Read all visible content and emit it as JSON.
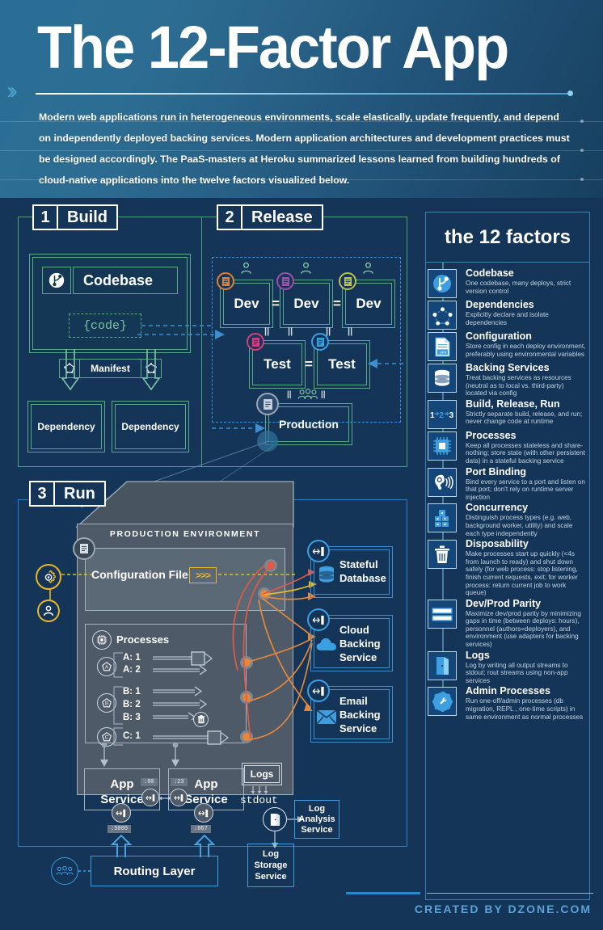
{
  "header": {
    "title": "The 12-Factor App",
    "subtitle": "Modern web applications run in heterogeneous environments, scale elastically, update frequently, and depend on independently deployed backing services. Modern application architectures and development practices must be designed accordingly. The PaaS-masters at Heroku summarized lessons learned from building hundreds of cloud-native applications into the twelve factors visualized below.",
    "chevron_icon": "double-chevron-right-icon"
  },
  "stages": [
    {
      "number": "1",
      "label": "Build"
    },
    {
      "number": "2",
      "label": "Release"
    },
    {
      "number": "3",
      "label": "Run"
    }
  ],
  "build": {
    "codebase_label": "Codebase",
    "codebase_icon": "git-branch-icon",
    "code_label": "{code}",
    "manifest_label": "Manifest",
    "manifest_icon_left": "pentagon-node-icon",
    "manifest_icon_right": "pentagon-node-icon",
    "dependencies": [
      "Dependency",
      "Dependency"
    ]
  },
  "release": {
    "dev_boxes": [
      "Dev",
      "Dev",
      "Dev"
    ],
    "test_boxes": [
      "Test",
      "Test"
    ],
    "production_label": "Production",
    "equals_label": "=",
    "parallel_label": "||",
    "user_icon": "person-icon",
    "group_icon": "people-group-icon",
    "doc_icon": "document-icon"
  },
  "run": {
    "prod_env_title": "PRODUCTION ENVIRONMENT",
    "config_file_label": "Configuration File",
    "config_arrows_label": ">>>",
    "gear_icon": "gear-config-icon",
    "person_icon": "person-circle-icon",
    "doc_icon": "document-circle-icon",
    "processes_label": "Processes",
    "processes_icon": "chip-icon",
    "process_groups": [
      {
        "icon": "pentagon-a-icon",
        "items": [
          "A: 1",
          "A: 2"
        ]
      },
      {
        "icon": "pentagon-b-icon",
        "items": [
          "B: 1",
          "B: 2",
          "B: 3"
        ]
      },
      {
        "icon": "pentagon-c-icon",
        "items": [
          "C: 1"
        ]
      }
    ],
    "trash_icon": "trash-icon",
    "app_services": [
      "App Service",
      "App Service"
    ],
    "app_service_label_line1": "App",
    "app_service_label_line2": "Service",
    "ports_top": [
      ":80",
      ":23"
    ],
    "ports_bottom": [
      ":5000",
      ":867"
    ],
    "port_icon": "port-binding-icon",
    "logs_label": "Logs",
    "stdout_label": "stdout",
    "log_door_icon": "door-icon",
    "log_analysis_label": "Log Analysis Service",
    "log_analysis_lines": [
      "Log",
      "Analysis",
      "Service"
    ],
    "log_storage_lines": [
      "Log",
      "Storage",
      "Service"
    ],
    "routing_layer_label": "Routing Layer",
    "users_icon": "users-circle-icon"
  },
  "backing_services": [
    {
      "lines": [
        "Stateful",
        "Database"
      ],
      "icon": "database-icon",
      "port_icon": "port-binding-icon"
    },
    {
      "lines": [
        "Cloud",
        "Backing",
        "Service"
      ],
      "icon": "cloud-icon",
      "port_icon": "port-binding-icon"
    },
    {
      "lines": [
        "Email",
        "Backing",
        "Service"
      ],
      "icon": "envelope-icon",
      "port_icon": "port-binding-icon"
    }
  ],
  "factors_panel": {
    "title": "the 12 factors",
    "items": [
      {
        "name": "Codebase",
        "desc": "One codebase, many deploys, strict version control",
        "icon": "git-branch-icon"
      },
      {
        "name": "Dependencies",
        "desc": "Explicitly declare and isolate dependencies",
        "icon": "dependency-graph-icon"
      },
      {
        "name": "Configuration",
        "desc": "Store config in each deploy environment, preferably using environmental variables",
        "icon": "yml-file-icon"
      },
      {
        "name": "Backing Services",
        "desc": "Treat backing services as resources (neutral as to local vs. third-party) located via config",
        "icon": "database-icon"
      },
      {
        "name": "Build, Release, Run",
        "desc": "Strictly separate build, release, and run; never change code at runtime",
        "icon": "one-two-three-icon"
      },
      {
        "name": "Processes",
        "desc": "Keep all processes stateless and share-nothing; store state (with other persistent data) in a stateful backing service",
        "icon": "chip-icon"
      },
      {
        "name": "Port Binding",
        "desc": "Bind every service to a port and listen on that port; don't rely on runtime server injection",
        "icon": "ear-listening-icon"
      },
      {
        "name": "Concurrency",
        "desc": "Distinguish process types (e.g. web, background worker, utility) and scale each type independently",
        "icon": "buildings-icon"
      },
      {
        "name": "Disposability",
        "desc": "Make processes start up quickly (<4s from launch to ready) and shut down safely (for web process: stop listening, finish current requests, exit; for worker process: return current job to work queue)",
        "icon": "trash-icon"
      },
      {
        "name": "Dev/Prod Parity",
        "desc": "Maximize dev/prod parity by minimizing gaps in time (between deploys: hours), personnel (authors=deployers), and environment (use adapters for backing services)",
        "icon": "two-bars-icon"
      },
      {
        "name": "Logs",
        "desc": "Log by writing all output streams to stdout; rout streams using non-app services",
        "icon": "door-icon"
      },
      {
        "name": "Admin Processes",
        "desc": "Run one-off/admin processes (db migration, REPL , one-time scripts) in same environment as normal processes",
        "icon": "gear-wrench-icon"
      }
    ]
  },
  "footer": {
    "credit": "CREATED BY DZONE.COM"
  },
  "colors": {
    "background": "#143458",
    "header_gradient_start": "#2a6e96",
    "header_gradient_end": "#17405f",
    "accent_blue": "#2e86c8",
    "accent_green": "#5aa98a",
    "accent_yellow": "#e8b72a",
    "accent_orange": "#e08030",
    "accent_red": "#e05a46",
    "factor_icon_bg": "#14467a",
    "grey_panel": "#4e5a68"
  }
}
